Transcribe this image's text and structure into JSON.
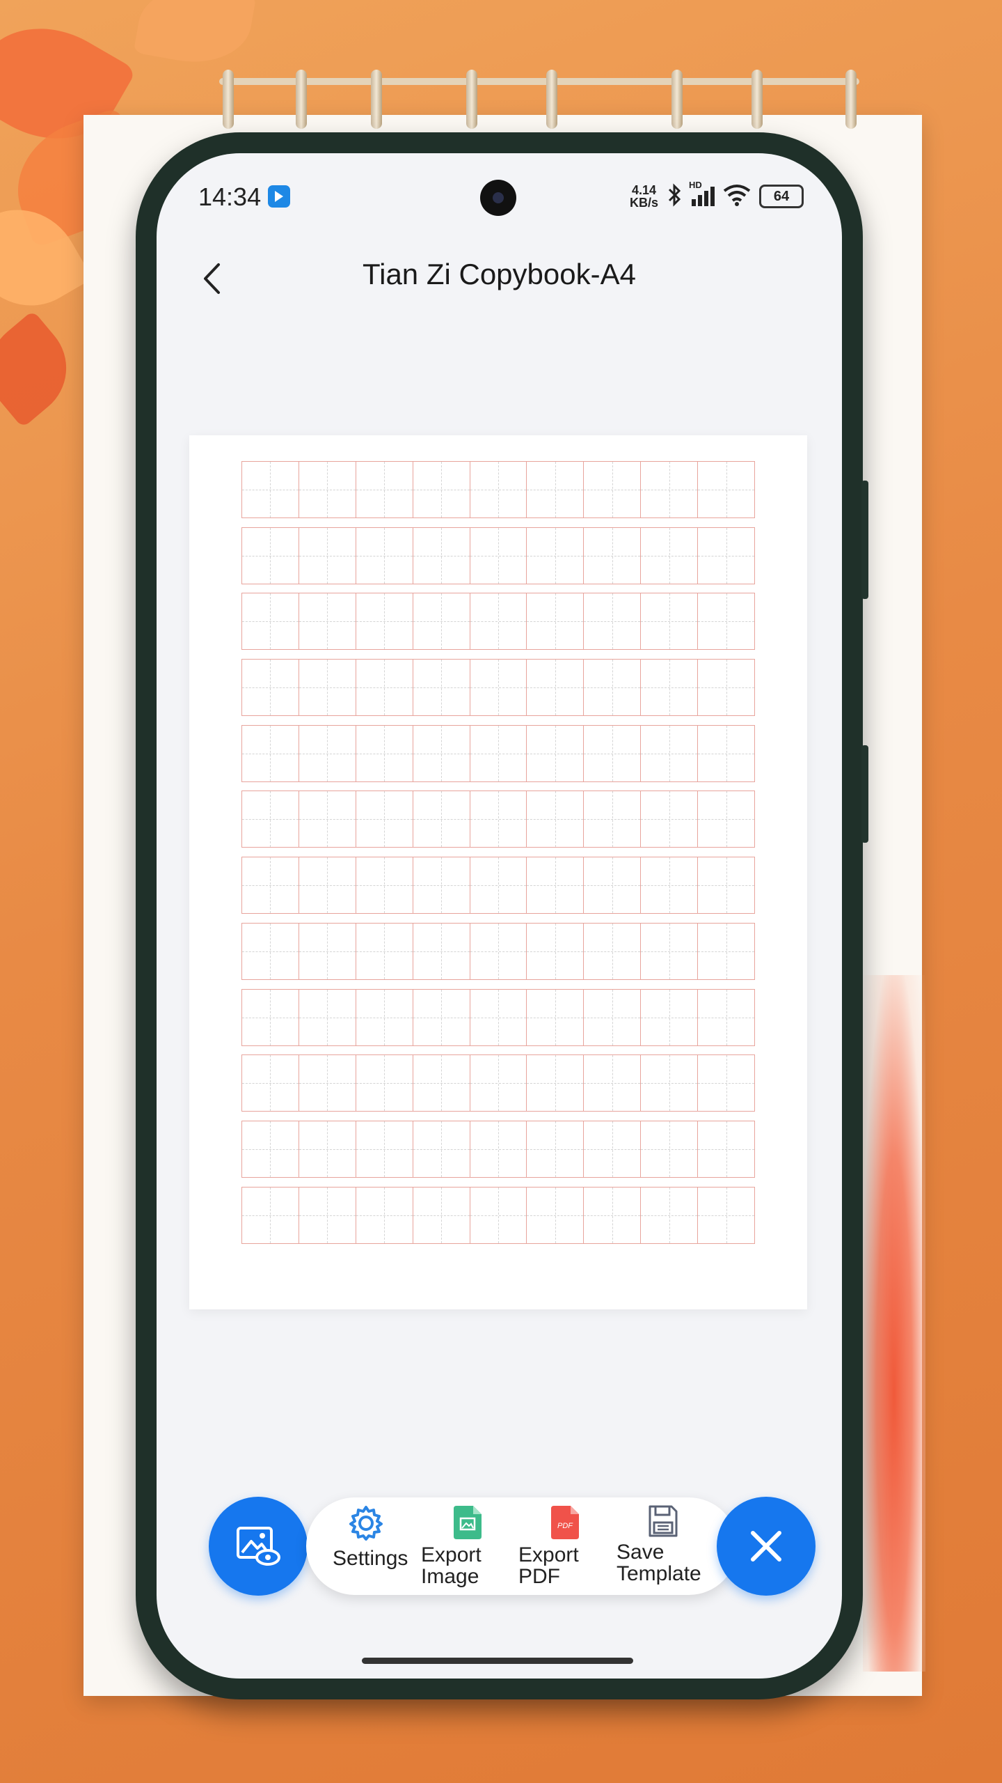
{
  "status_bar": {
    "time": "14:34",
    "net_speed_value": "4.14",
    "net_speed_unit": "KB/s",
    "signal_label": "HD",
    "battery": "64"
  },
  "header": {
    "title": "Tian Zi Copybook-A4"
  },
  "toolbar": {
    "settings_label": "Settings",
    "export_image_label": "Export Image",
    "export_pdf_label": "Export PDF",
    "pdf_icon_text": "PDF",
    "save_template_label": "Save Template"
  },
  "copybook": {
    "rows": 12,
    "cells_per_row": 9,
    "grid_color": "#e8a49c",
    "guide_color": "#d4d4d4"
  },
  "colors": {
    "accent": "#1677ee",
    "export_image_icon": "#3dbb8a",
    "export_pdf_icon": "#f0524a",
    "background": "#e88a45"
  }
}
